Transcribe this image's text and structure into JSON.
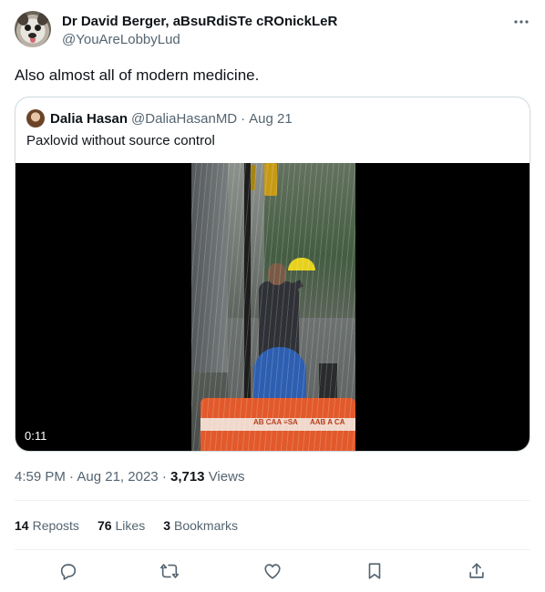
{
  "tweet": {
    "display_name": "Dr David Berger, aBsuRdiSTe cROnickLeR",
    "handle": "@YouAreLobbyLud",
    "text": "Also almost all of modern medicine."
  },
  "quoted": {
    "display_name": "Dalia Hasan",
    "handle": "@DaliaHasanMD",
    "separator": "·",
    "date": "Aug 21",
    "text": "Paxlovid without source control",
    "video_duration": "0:11",
    "barrier_text_1": "AB   CAA ≡SA",
    "barrier_text_2": "AAB A  CA"
  },
  "meta": {
    "time": "4:59 PM",
    "separator": "·",
    "date": "Aug 21, 2023",
    "views_count": "3,713",
    "views_label": "Views"
  },
  "stats": {
    "reposts_count": "14",
    "reposts_label": "Reposts",
    "likes_count": "76",
    "likes_label": "Likes",
    "bookmarks_count": "3",
    "bookmarks_label": "Bookmarks"
  },
  "icons": {
    "more": "more-dots-icon",
    "reply": "reply-icon",
    "repost": "repost-icon",
    "like": "heart-icon",
    "bookmark": "bookmark-icon",
    "share": "share-icon"
  },
  "colors": {
    "text": "#0f1419",
    "secondary": "#536471",
    "border": "#cfd9de",
    "divider": "#eff3f4"
  }
}
